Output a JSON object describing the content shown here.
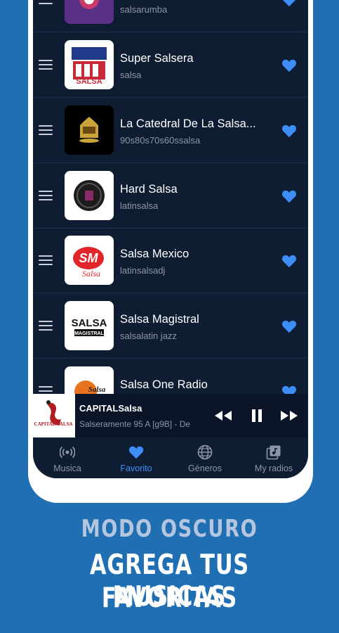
{
  "stations": [
    {
      "name": "",
      "genre": "salsarumba",
      "logo": "salsarumba-logo"
    },
    {
      "name": "Super Salsera",
      "genre": "salsa",
      "logo": "super-salsera-logo",
      "logo_text": "SALSA"
    },
    {
      "name": "La Catedral De La Salsa...",
      "genre": "90s80s70s60ssalsa",
      "logo": "catedral-logo"
    },
    {
      "name": "Hard Salsa",
      "genre": "latinsalsa",
      "logo": "hard-salsa-logo"
    },
    {
      "name": "Salsa Mexico",
      "genre": "latinsalsadj",
      "logo": "salsa-mexico-logo",
      "logo_text": "SM",
      "logo_sub": "Salsa"
    },
    {
      "name": "Salsa Magistral",
      "genre": "salsalatin jazz",
      "logo": "salsa-magistral-logo",
      "logo_text": "SALSA",
      "logo_sub": "MAGISTRAL"
    },
    {
      "name": "Salsa One Radio",
      "genre": "",
      "logo": "salsa-one-logo",
      "logo_text": "Salsa"
    }
  ],
  "favorite_icon": "heart-icon",
  "favorite_color": "#3d8ef7",
  "mini_player": {
    "title": "CAPITALSalsa",
    "subtitle": "Salseramente 95 A [g9B] - De",
    "thumb_text": "CAPITAL SALSA",
    "controls": [
      "rewind-icon",
      "pause-icon",
      "fast-forward-icon"
    ]
  },
  "nav": {
    "items": [
      {
        "label": "Musica",
        "icon": "radio-waves-icon"
      },
      {
        "label": "Favorito",
        "icon": "heart-icon",
        "active": true
      },
      {
        "label": "Géneros",
        "icon": "globe-icon"
      },
      {
        "label": "My radios",
        "icon": "music-library-icon"
      }
    ]
  },
  "promo": {
    "line1": "MODO OSCURO",
    "line2": "AGREGA TUS MUSICAS",
    "line3": "FAVORITAS"
  },
  "colors": {
    "background": "#1f6fb2",
    "screen": "#0f1d33",
    "accent": "#3d8ef7"
  }
}
